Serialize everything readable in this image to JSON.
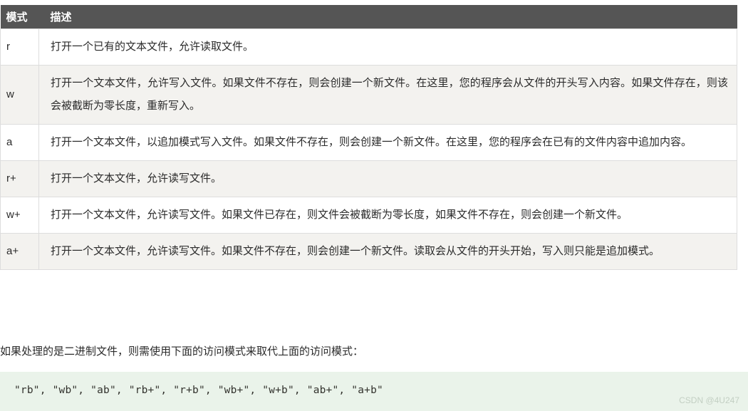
{
  "table": {
    "headers": [
      "模式",
      "描述"
    ],
    "rows": [
      {
        "mode": "r",
        "description": "打开一个已有的文本文件，允许读取文件。"
      },
      {
        "mode": "w",
        "description": "打开一个文本文件，允许写入文件。如果文件不存在，则会创建一个新文件。在这里，您的程序会从文件的开头写入内容。如果文件存在，则该会被截断为零长度，重新写入。"
      },
      {
        "mode": "a",
        "description": "打开一个文本文件，以追加模式写入文件。如果文件不存在，则会创建一个新文件。在这里，您的程序会在已有的文件内容中追加内容。"
      },
      {
        "mode": "r+",
        "description": "打开一个文本文件，允许读写文件。"
      },
      {
        "mode": "w+",
        "description": "打开一个文本文件，允许读写文件。如果文件已存在，则文件会被截断为零长度，如果文件不存在，则会创建一个新文件。"
      },
      {
        "mode": "a+",
        "description": "打开一个文本文件，允许读写文件。如果文件不存在，则会创建一个新文件。读取会从文件的开头开始，写入则只能是追加模式。"
      }
    ]
  },
  "note": {
    "text": "如果处理的是二进制文件，则需使用下面的访问模式来取代上面的访问模式："
  },
  "code": {
    "line": "\"rb\", \"wb\", \"ab\", \"rb+\", \"r+b\", \"wb+\", \"w+b\", \"ab+\", \"a+b\""
  },
  "watermark": {
    "text": "CSDN @4U247"
  },
  "colors": {
    "header_bg": "#555555",
    "header_text": "#ffffff",
    "row_alt_bg": "#f3f2ef",
    "row_bg": "#ffffff",
    "border": "#dddddd",
    "body_text": "#2b2b2b",
    "code_bg": "#eaf3ea",
    "code_text": "#33332e",
    "watermark_text": "#c3cfc3"
  }
}
